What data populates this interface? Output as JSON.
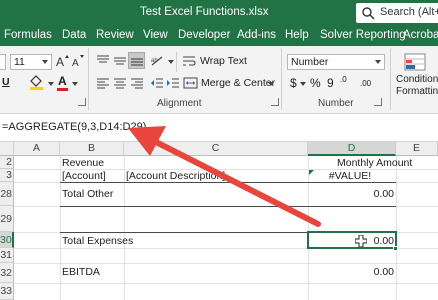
{
  "window": {
    "title": "Test Excel Functions.xlsx",
    "search_text": "Search (Alt+Q)"
  },
  "ribbon_tabs": [
    "Formulas",
    "Data",
    "Review",
    "View",
    "Developer",
    "Add-ins",
    "Help",
    "Solver Reporting",
    "Acrobat"
  ],
  "ribbon": {
    "font_size": "11",
    "wrap_text": "Wrap Text",
    "merge_center": "Merge & Center",
    "alignment_label": "Alignment",
    "number_format": "Number",
    "number_label": "Number",
    "number_symbol": "$",
    "percent_symbol": "%",
    "comma_symbol": "9",
    "conditional_formatting": [
      "Conditional",
      "Formatting"
    ],
    "underline_letter": "U",
    "font_color_letter": "A",
    "decrease_decimal": ".00",
    "increase_decimal": ".0"
  },
  "formula_bar": {
    "formula": "=AGGREGATE(9,3,D14:D29)"
  },
  "sheet": {
    "columns": [
      "A",
      "B",
      "C",
      "D",
      "E"
    ],
    "active_column": "D",
    "rows": [
      "2",
      "3",
      "28",
      "29",
      "30",
      "31",
      "32",
      "33"
    ],
    "active_row": "30",
    "cells": {
      "b2": "Revenue",
      "d2": "Monthly Amount",
      "b3": "[Account]",
      "c3": "[Account Description]",
      "d3": "#VALUE!",
      "b28": "Total Other",
      "d28": "0.00",
      "b30": "Total Expenses",
      "d30": "0.00",
      "b32": "EBITDA",
      "d32": "0.00"
    }
  },
  "colors": {
    "excel_green": "#217346",
    "annotation_arrow": "#e8453c"
  }
}
